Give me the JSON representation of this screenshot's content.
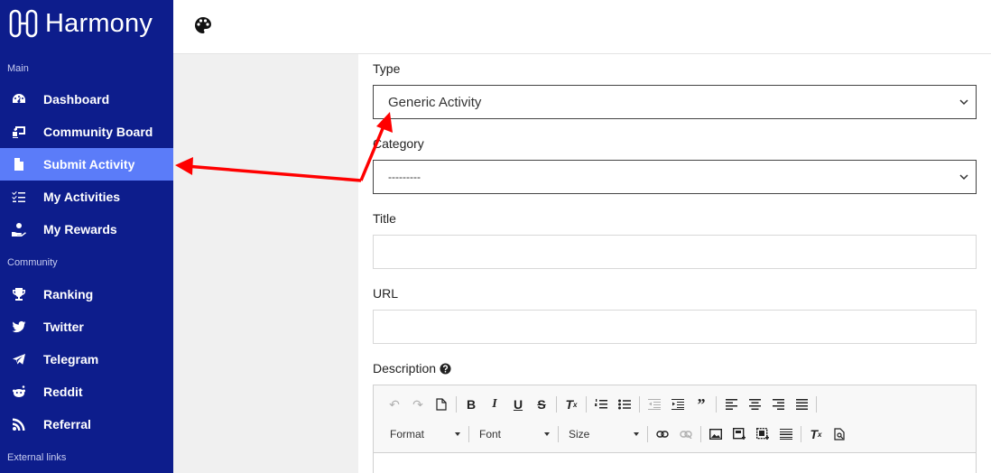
{
  "brand": {
    "name": "Harmony"
  },
  "sidebar": {
    "sections": [
      {
        "label": "Main"
      },
      {
        "label": "Community"
      },
      {
        "label": "External links"
      }
    ],
    "main_items": [
      {
        "label": "Dashboard",
        "icon": "gauge-icon"
      },
      {
        "label": "Community Board",
        "icon": "board-icon"
      },
      {
        "label": "Submit Activity",
        "icon": "file-icon",
        "active": true
      },
      {
        "label": "My Activities",
        "icon": "checklist-icon"
      },
      {
        "label": "My Rewards",
        "icon": "hand-reward-icon"
      }
    ],
    "community_items": [
      {
        "label": "Ranking",
        "icon": "trophy-icon"
      },
      {
        "label": "Twitter",
        "icon": "twitter-icon"
      },
      {
        "label": "Telegram",
        "icon": "telegram-icon"
      },
      {
        "label": "Reddit",
        "icon": "reddit-icon"
      },
      {
        "label": "Referral",
        "icon": "rss-icon"
      }
    ]
  },
  "topbar": {
    "icon": "palette-icon"
  },
  "form": {
    "type": {
      "label": "Type",
      "value": "Generic Activity"
    },
    "category": {
      "label": "Category",
      "value": "---------"
    },
    "title": {
      "label": "Title",
      "value": ""
    },
    "url": {
      "label": "URL",
      "value": ""
    },
    "description": {
      "label": "Description"
    }
  },
  "editor": {
    "format_label": "Format",
    "font_label": "Font",
    "size_label": "Size"
  },
  "colors": {
    "sidebar_bg": "#0d1d8c",
    "active_item": "#5b7cf9",
    "annotation_arrow": "#ff0000"
  }
}
